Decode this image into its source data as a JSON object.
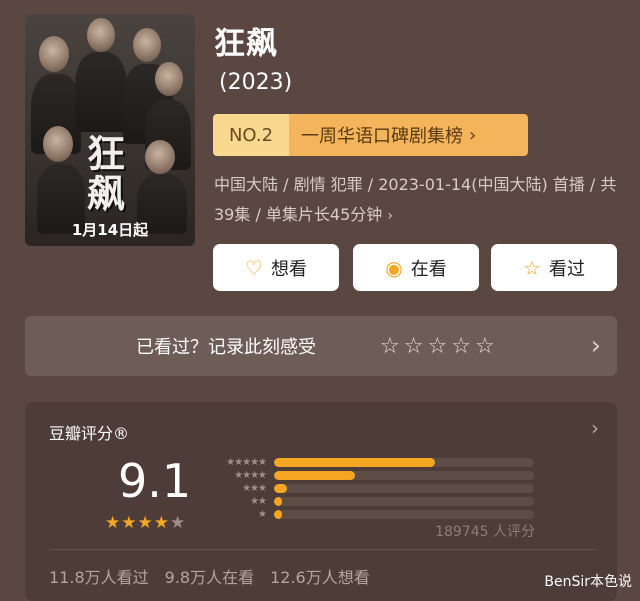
{
  "poster": {
    "title_art": "狂飙",
    "date_art": "1月14日起"
  },
  "header": {
    "title": "狂飙",
    "year": "(2023)"
  },
  "rank": {
    "number": "NO.2",
    "list_name": "一周华语口碑剧集榜",
    "arrow": "›"
  },
  "meta": {
    "text": "中国大陆 / 剧情 犯罪 / 2023-01-14(中国大陆) 首播 / 共39集 / 单集片长45分钟",
    "arrow": "›"
  },
  "actions": [
    {
      "icon": "heart-plus-icon",
      "glyph": "♡",
      "label": "想看"
    },
    {
      "icon": "in-progress-icon",
      "glyph": "◉",
      "label": "在看"
    },
    {
      "icon": "star-icon",
      "glyph": "☆",
      "label": "看过"
    }
  ],
  "rate_prompt": {
    "text": "已看过？记录此刻感受",
    "stars": [
      "☆",
      "☆",
      "☆",
      "☆",
      "☆"
    ],
    "chevron": "›"
  },
  "score": {
    "title": "豆瓣评分®",
    "chevron": "›",
    "value": "9.1",
    "stars": [
      "★",
      "★",
      "★",
      "★",
      "★"
    ],
    "star_rating": 4.5,
    "distribution": [
      {
        "stars": "★★★★★",
        "fraction": 0.62
      },
      {
        "stars": "★★★★",
        "fraction": 0.31
      },
      {
        "stars": "★★★",
        "fraction": 0.05
      },
      {
        "stars": "★★",
        "fraction": 0.03
      },
      {
        "stars": "★",
        "fraction": 0.03
      }
    ],
    "vote_count": "189745 人评分"
  },
  "watch_stats": [
    "11.8万人看过",
    "9.8万人在看",
    "12.6万人想看"
  ],
  "watermark": "BenSir本色说",
  "colors": {
    "background": "#5b4741",
    "accent": "#f5a623",
    "badge_light": "#f8d98f",
    "badge_dark": "#f3b45b"
  }
}
